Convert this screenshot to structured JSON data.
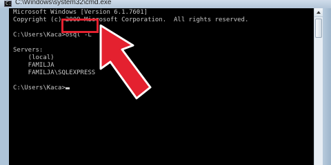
{
  "window": {
    "title": "C:\\Windows\\system32\\cmd.exe",
    "icon": "console-icon"
  },
  "console": {
    "lines": [
      "Microsoft Windows [Version 6.1.7601]",
      "Copyright (c) 2009 Microsoft Corporation.  All rights reserved.",
      "",
      "C:\\Users\\Kaca>osql -L",
      "",
      "Servers:",
      "    (local)",
      "    FAMILJA",
      "    FAMILJA\\SQLEXPRESS",
      ""
    ],
    "prompt": "C:\\Users\\Kaca>"
  },
  "annotation": {
    "color": "#e4212f",
    "shape": "arrow",
    "highlighted_text": "osql -L"
  },
  "colors": {
    "console_bg": "#000000",
    "console_fg": "#c8c8c8",
    "frame": "#aec4d8"
  }
}
